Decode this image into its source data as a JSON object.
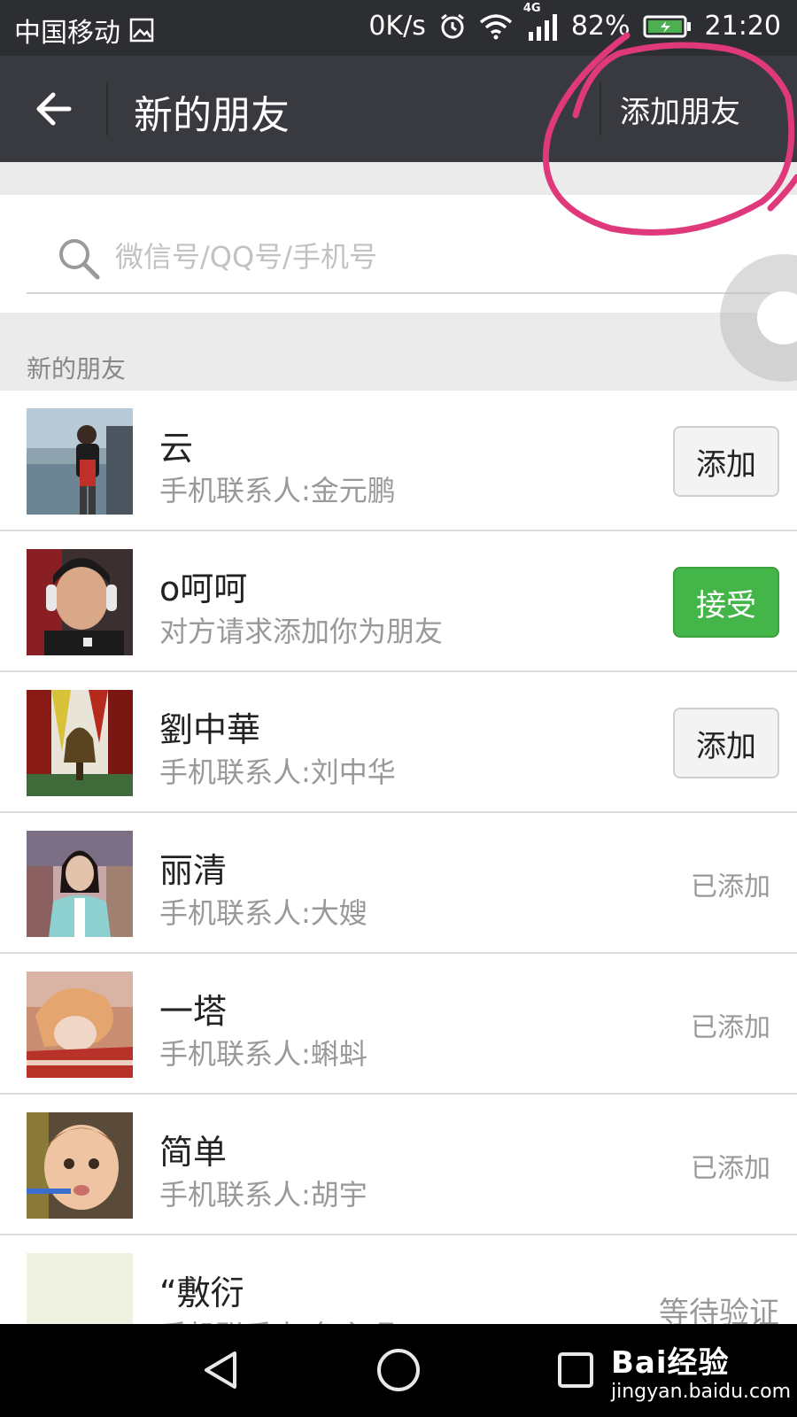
{
  "status_bar": {
    "carrier": "中国移动",
    "speed": "0K/s",
    "network": "4G",
    "battery": "82%",
    "time": "21:20",
    "bg_color": "#2d2e32"
  },
  "header": {
    "title": "新的朋友",
    "add_friend_label": "添加朋友",
    "bg_color": "#393a3f"
  },
  "search": {
    "placeholder": "微信号/QQ号/手机号",
    "value": ""
  },
  "section": {
    "title": "新的朋友"
  },
  "friends": [
    {
      "name": "云",
      "subtitle": "手机联系人:金元鹏",
      "action": "添加",
      "action_type": "add-button"
    },
    {
      "name": "o呵呵",
      "subtitle": "对方请求添加你为朋友",
      "action": "接受",
      "action_type": "accept-button"
    },
    {
      "name": "劉中華",
      "subtitle": "手机联系人:刘中华",
      "action": "添加",
      "action_type": "add-button"
    },
    {
      "name": "丽清",
      "subtitle": "手机联系人:大嫂",
      "action": "已添加",
      "action_type": "status-text"
    },
    {
      "name": "一塔",
      "subtitle": "手机联系人:蝌蚪",
      "action": "已添加",
      "action_type": "status-text"
    },
    {
      "name": "简单",
      "subtitle": "手机联系人:胡宇",
      "action": "已添加",
      "action_type": "status-text"
    },
    {
      "name": "“敷衍",
      "subtitle": "手机联系人:鱼主呢",
      "action": "等待验证",
      "action_type": "status-text"
    }
  ],
  "watermark": {
    "brand": "Bai经验",
    "url": "jingyan.baidu.com"
  },
  "colors": {
    "accept_green": "#44b549",
    "annotation_pink": "#e0397b",
    "list_divider": "#dedede",
    "section_bg": "#ebebeb"
  },
  "icons": {
    "back": "arrow-left-icon",
    "search": "search-icon",
    "nav_back": "triangle-back-icon",
    "nav_home": "circle-home-icon",
    "nav_recent": "square-recent-icon"
  }
}
